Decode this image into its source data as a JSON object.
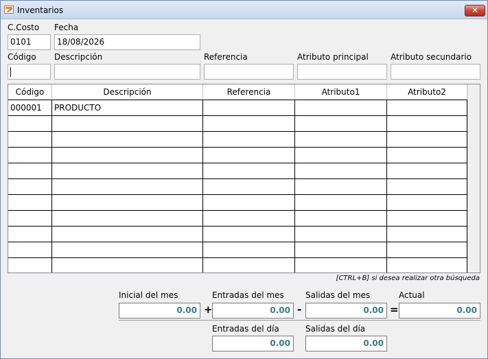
{
  "window": {
    "title": "Inventarios",
    "close_label": "✕"
  },
  "header": {
    "ccosto_label": "C.Costo",
    "ccosto_value": "0101",
    "fecha_label": "Fecha",
    "fecha_value": "18/08/2026"
  },
  "filters": {
    "codigo_label": "Código",
    "descripcion_label": "Descripción",
    "referencia_label": "Referencia",
    "atributo_principal_label": "Atributo principal",
    "atributo_secundario_label": "Atributo secundario"
  },
  "grid": {
    "columns": [
      "Código",
      "Descripción",
      "Referencia",
      "Atributo1",
      "Atributo2"
    ],
    "rows": [
      [
        "000001",
        "PRODUCTO",
        "",
        "",
        ""
      ],
      [
        "",
        "",
        "",
        "",
        ""
      ],
      [
        "",
        "",
        "",
        "",
        ""
      ],
      [
        "",
        "",
        "",
        "",
        ""
      ],
      [
        "",
        "",
        "",
        "",
        ""
      ],
      [
        "",
        "",
        "",
        "",
        ""
      ],
      [
        "",
        "",
        "",
        "",
        ""
      ],
      [
        "",
        "",
        "",
        "",
        ""
      ],
      [
        "",
        "",
        "",
        "",
        ""
      ],
      [
        "",
        "",
        "",
        "",
        ""
      ],
      [
        "",
        "",
        "",
        "",
        ""
      ]
    ]
  },
  "hint": "[CTRL+B] si desea realizar otra búsqueda",
  "summary": {
    "inicial_label": "Inicial del mes",
    "inicial_value": "0.00",
    "plus": "+",
    "entradas_mes_label": "Entradas del mes",
    "entradas_mes_value": "0.00",
    "minus": "-",
    "salidas_mes_label": "Salidas del mes",
    "salidas_mes_value": "0.00",
    "equals": "=",
    "actual_label": "Actual",
    "actual_value": "0.00",
    "entradas_dia_label": "Entradas del día",
    "entradas_dia_value": "0.00",
    "salidas_dia_label": "Salidas del día",
    "salidas_dia_value": "0.00"
  }
}
